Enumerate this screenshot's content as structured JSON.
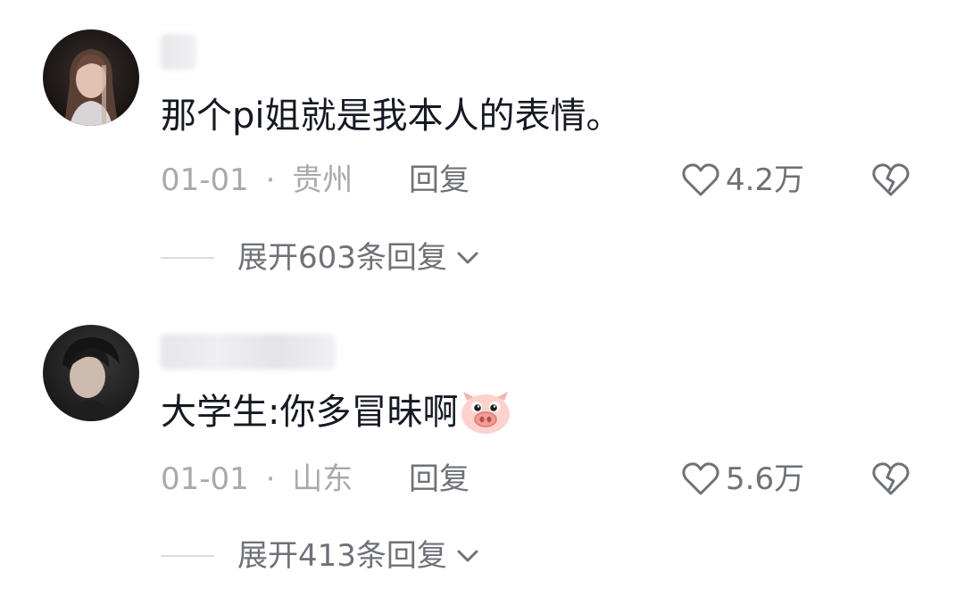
{
  "comments": [
    {
      "text": "那个pi姐就是我本人的表情。",
      "date": "01-01",
      "separator": "·",
      "location": "贵州",
      "reply_label": "回复",
      "likes": "4.2万",
      "expand_label": "展开603条回复"
    },
    {
      "text": "大学生:你多冒昧啊",
      "emoji": "pig-face-emoji",
      "date": "01-01",
      "separator": "·",
      "location": "山东",
      "reply_label": "回复",
      "likes": "5.6万",
      "expand_label": "展开413条回复"
    }
  ],
  "colors": {
    "text_primary": "#161823",
    "text_meta": "#a7a9ae",
    "text_secondary": "#6f7179",
    "divider": "#dadbde"
  },
  "icons": [
    "heart-outline-icon",
    "broken-heart-icon",
    "chevron-down-icon"
  ]
}
